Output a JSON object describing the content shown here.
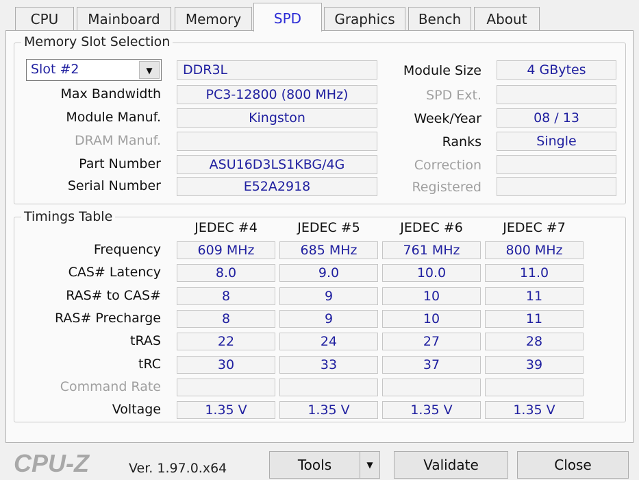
{
  "tabs": [
    "CPU",
    "Mainboard",
    "Memory",
    "SPD",
    "Graphics",
    "Bench",
    "About"
  ],
  "active_tab": "SPD",
  "slot": {
    "legend": "Memory Slot Selection",
    "selected_slot": "Slot #2",
    "type": "DDR3L",
    "left": [
      {
        "label": "Max Bandwidth",
        "value": "PC3-12800 (800 MHz)",
        "disabled": false
      },
      {
        "label": "Module Manuf.",
        "value": "Kingston",
        "disabled": false
      },
      {
        "label": "DRAM Manuf.",
        "value": "",
        "disabled": true
      },
      {
        "label": "Part Number",
        "value": "ASU16D3LS1KBG/4G",
        "disabled": false
      },
      {
        "label": "Serial Number",
        "value": "E52A2918",
        "disabled": false
      }
    ],
    "right": [
      {
        "label": "Module Size",
        "value": "4 GBytes",
        "disabled": false
      },
      {
        "label": "SPD Ext.",
        "value": "",
        "disabled": true
      },
      {
        "label": "Week/Year",
        "value": "08 / 13",
        "disabled": false
      },
      {
        "label": "Ranks",
        "value": "Single",
        "disabled": false
      },
      {
        "label": "Correction",
        "value": "",
        "disabled": true
      },
      {
        "label": "Registered",
        "value": "",
        "disabled": true
      }
    ]
  },
  "timings": {
    "legend": "Timings Table",
    "columns": [
      "JEDEC #4",
      "JEDEC #5",
      "JEDEC #6",
      "JEDEC #7"
    ],
    "rows": [
      {
        "label": "Frequency",
        "values": [
          "609 MHz",
          "685 MHz",
          "761 MHz",
          "800 MHz"
        ],
        "disabled": false
      },
      {
        "label": "CAS# Latency",
        "values": [
          "8.0",
          "9.0",
          "10.0",
          "11.0"
        ],
        "disabled": false
      },
      {
        "label": "RAS# to CAS#",
        "values": [
          "8",
          "9",
          "10",
          "11"
        ],
        "disabled": false
      },
      {
        "label": "RAS# Precharge",
        "values": [
          "8",
          "9",
          "10",
          "11"
        ],
        "disabled": false
      },
      {
        "label": "tRAS",
        "values": [
          "22",
          "24",
          "27",
          "28"
        ],
        "disabled": false
      },
      {
        "label": "tRC",
        "values": [
          "30",
          "33",
          "37",
          "39"
        ],
        "disabled": false
      },
      {
        "label": "Command Rate",
        "values": [
          "",
          "",
          "",
          ""
        ],
        "disabled": true
      },
      {
        "label": "Voltage",
        "values": [
          "1.35 V",
          "1.35 V",
          "1.35 V",
          "1.35 V"
        ],
        "disabled": false
      }
    ]
  },
  "footer": {
    "logo": "CPU-Z",
    "version": "Ver. 1.97.0.x64",
    "tools": "Tools",
    "validate": "Validate",
    "close": "Close"
  }
}
